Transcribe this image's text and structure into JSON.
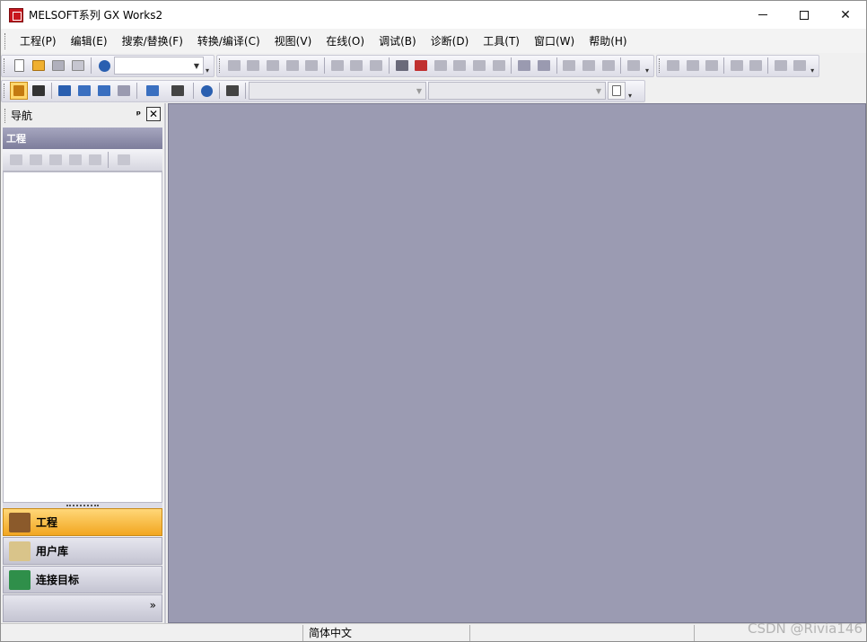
{
  "window": {
    "title": "MELSOFT系列 GX Works2",
    "controls": {
      "minimize": "",
      "maximize": "",
      "close": "✕"
    }
  },
  "menu": [
    {
      "label": "工程(P)"
    },
    {
      "label": "编辑(E)"
    },
    {
      "label": "搜索/替换(F)"
    },
    {
      "label": "转换/编译(C)"
    },
    {
      "label": "视图(V)"
    },
    {
      "label": "在线(O)"
    },
    {
      "label": "调试(B)"
    },
    {
      "label": "诊断(D)"
    },
    {
      "label": "工具(T)"
    },
    {
      "label": "窗口(W)"
    },
    {
      "label": "帮助(H)"
    }
  ],
  "toolbar": {
    "combo_value": "",
    "dropdown_arrow": "▼",
    "overflow_arrow": "▾",
    "icon_colors": {
      "new": "#ffffff",
      "open": "#f0b030",
      "save": "#6a8fbf",
      "print": "#9a9aa8",
      "help": "#2a5fb0",
      "disabled": "#b6b6c2",
      "dev": "#3a6fc0",
      "find": "#444444"
    }
  },
  "navigation": {
    "title": "导航",
    "pin": "ᵖ",
    "close": "✕",
    "project_header": "工程",
    "tabs": [
      {
        "label": "工程",
        "icon": "project-icon",
        "active": true
      },
      {
        "label": "用户库",
        "icon": "user-library-icon",
        "active": false
      },
      {
        "label": "连接目标",
        "icon": "connection-destination-icon",
        "active": false
      }
    ],
    "more": "»"
  },
  "statusbar": {
    "language": "简体中文",
    "watermark": "CSDN @Rivia146"
  },
  "colors": {
    "workspace": "#9b9bb2",
    "active_tab": "#f2a620",
    "project_header": "#7d7d9b"
  }
}
